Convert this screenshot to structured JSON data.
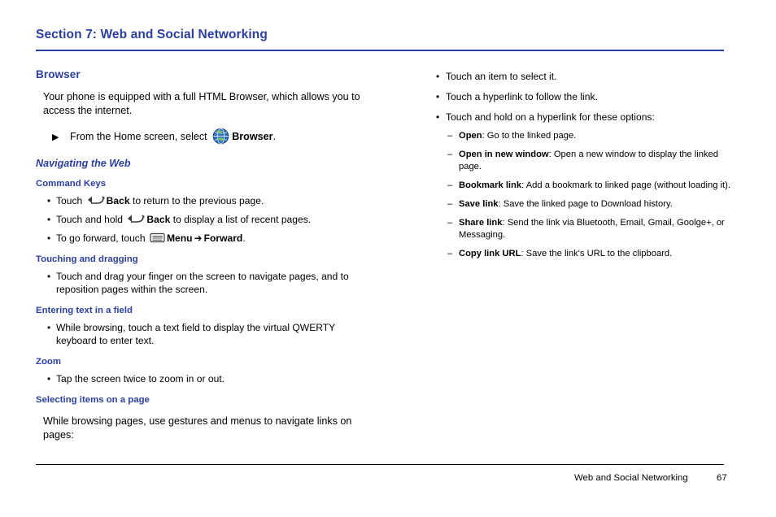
{
  "section": {
    "title": "Section 7: Web and Social Networking"
  },
  "left": {
    "browser_heading": "Browser",
    "intro": "Your phone is equipped with a full HTML Browser, which allows you to access the internet.",
    "home_step": {
      "prefix": "From the Home screen, select",
      "icon": "globe-browser-icon",
      "bold": "Browser",
      "suffix": "."
    },
    "navigating_heading": "Navigating the Web",
    "command_keys_heading": "Command Keys",
    "command_keys": [
      {
        "pre": "Touch",
        "icon": "back-arrow-icon",
        "bold": "Back",
        "post": "to return to the previous page."
      },
      {
        "pre": "Touch and hold",
        "icon": "back-arrow-icon",
        "bold": "Back",
        "post": "to display a list of recent pages."
      },
      {
        "pre": "To go forward, touch",
        "icon": "menu-icon",
        "bold": "Menu",
        "arrow": "➜",
        "bold2": "Forward",
        "post": "."
      }
    ],
    "touching_heading": "Touching and dragging",
    "touching_bullets": [
      "Touch and drag your finger on the screen to navigate pages, and to reposition pages within the screen."
    ],
    "entering_heading": "Entering text in a field",
    "entering_bullets": [
      "While browsing, touch a text field to display the virtual QWERTY keyboard to enter text."
    ],
    "zoom_heading": "Zoom",
    "zoom_bullets": [
      "Tap the screen twice to zoom in or out."
    ],
    "selecting_heading": "Selecting items on a page",
    "selecting_para": "While browsing pages, use gestures and menus to navigate links on pages:"
  },
  "right": {
    "bullets": [
      "Touch an item to select it.",
      "Touch a hyperlink to follow the link.",
      "Touch and hold on a hyperlink for these options:"
    ],
    "options": [
      {
        "term": "Open",
        "desc": ": Go to the linked page."
      },
      {
        "term": "Open in new window",
        "desc": ": Open a new window to display the linked page."
      },
      {
        "term": "Bookmark link",
        "desc": ": Add a bookmark to linked page (without loading it)."
      },
      {
        "term": "Save link",
        "desc": ": Save the linked page to Download history."
      },
      {
        "term": "Share link",
        "desc": ": Send the link via Bluetooth, Email, Gmail, Goolge+, or Messaging."
      },
      {
        "term": "Copy link URL",
        "desc": ": Save the link's URL to the clipboard."
      }
    ]
  },
  "footer": {
    "text": "Web and Social Networking",
    "page": "67"
  },
  "colors": {
    "heading_blue": "#2b3f9e",
    "body_black": "#000000"
  }
}
